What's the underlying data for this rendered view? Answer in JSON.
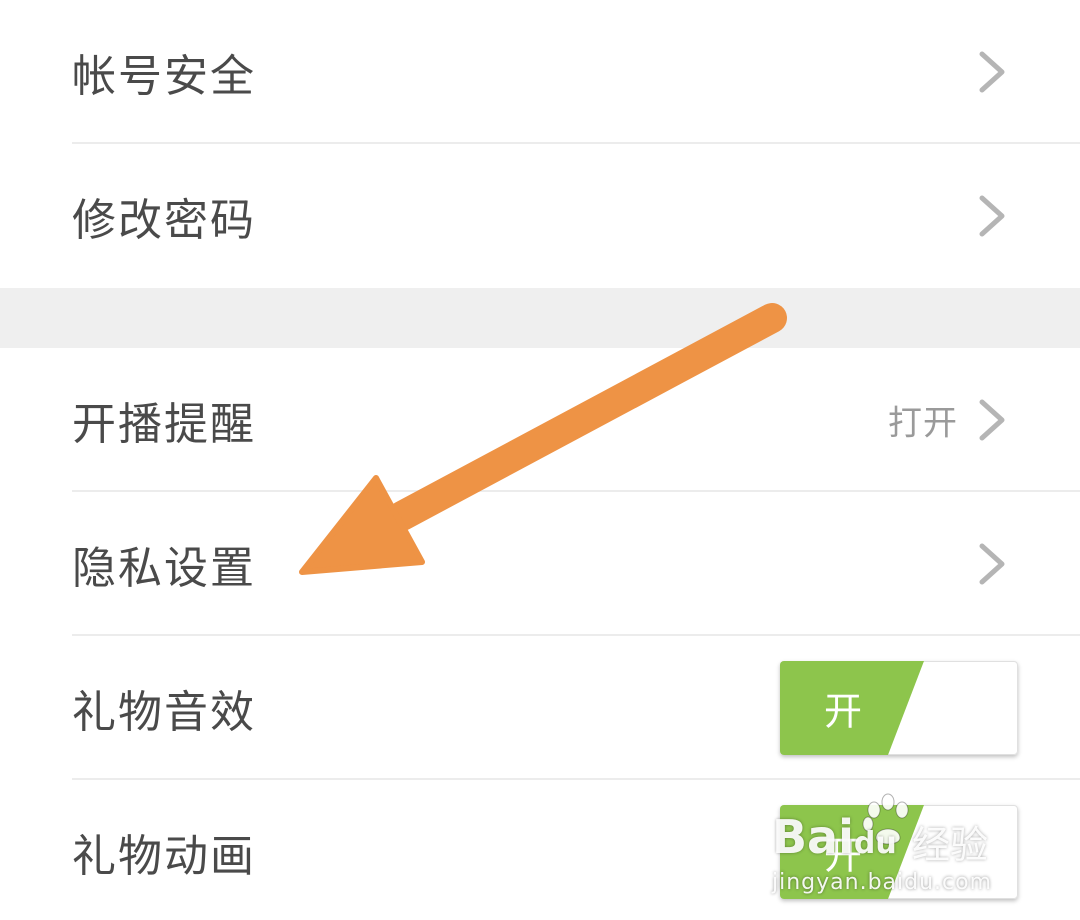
{
  "settings": {
    "account_security": {
      "label": "帐号安全"
    },
    "change_password": {
      "label": "修改密码"
    },
    "live_reminder": {
      "label": "开播提醒",
      "value": "打开"
    },
    "privacy_settings": {
      "label": "隐私设置"
    },
    "gift_sound": {
      "label": "礼物音效",
      "toggle_label": "开",
      "enabled": true
    },
    "gift_animation": {
      "label": "礼物动画",
      "toggle_label": "开",
      "enabled": true
    }
  },
  "colors": {
    "toggle_on": "#8dc54c",
    "annotation_arrow": "#ee9345",
    "section_gap": "#efefef"
  },
  "icons": {
    "chevron": "chevron-right-icon",
    "annotation": "arrow-annotation-icon",
    "watermark": "baidu-paw-icon"
  },
  "watermark": {
    "brand": "Bai",
    "brand_suffix": "du",
    "cn": "经验",
    "url": "jingyan.baidu.com"
  }
}
